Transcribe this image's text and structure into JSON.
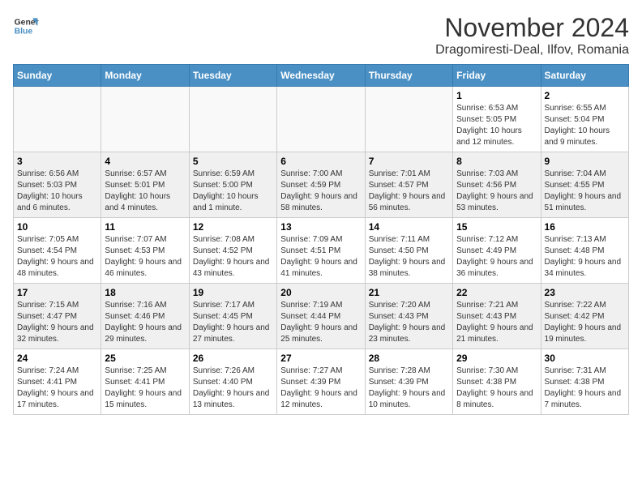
{
  "logo": {
    "line1": "General",
    "line2": "Blue"
  },
  "title": "November 2024",
  "location": "Dragomiresti-Deal, Ilfov, Romania",
  "weekdays": [
    "Sunday",
    "Monday",
    "Tuesday",
    "Wednesday",
    "Thursday",
    "Friday",
    "Saturday"
  ],
  "weeks": [
    [
      {
        "day": "",
        "info": ""
      },
      {
        "day": "",
        "info": ""
      },
      {
        "day": "",
        "info": ""
      },
      {
        "day": "",
        "info": ""
      },
      {
        "day": "",
        "info": ""
      },
      {
        "day": "1",
        "info": "Sunrise: 6:53 AM\nSunset: 5:05 PM\nDaylight: 10 hours and 12 minutes."
      },
      {
        "day": "2",
        "info": "Sunrise: 6:55 AM\nSunset: 5:04 PM\nDaylight: 10 hours and 9 minutes."
      }
    ],
    [
      {
        "day": "3",
        "info": "Sunrise: 6:56 AM\nSunset: 5:03 PM\nDaylight: 10 hours and 6 minutes."
      },
      {
        "day": "4",
        "info": "Sunrise: 6:57 AM\nSunset: 5:01 PM\nDaylight: 10 hours and 4 minutes."
      },
      {
        "day": "5",
        "info": "Sunrise: 6:59 AM\nSunset: 5:00 PM\nDaylight: 10 hours and 1 minute."
      },
      {
        "day": "6",
        "info": "Sunrise: 7:00 AM\nSunset: 4:59 PM\nDaylight: 9 hours and 58 minutes."
      },
      {
        "day": "7",
        "info": "Sunrise: 7:01 AM\nSunset: 4:57 PM\nDaylight: 9 hours and 56 minutes."
      },
      {
        "day": "8",
        "info": "Sunrise: 7:03 AM\nSunset: 4:56 PM\nDaylight: 9 hours and 53 minutes."
      },
      {
        "day": "9",
        "info": "Sunrise: 7:04 AM\nSunset: 4:55 PM\nDaylight: 9 hours and 51 minutes."
      }
    ],
    [
      {
        "day": "10",
        "info": "Sunrise: 7:05 AM\nSunset: 4:54 PM\nDaylight: 9 hours and 48 minutes."
      },
      {
        "day": "11",
        "info": "Sunrise: 7:07 AM\nSunset: 4:53 PM\nDaylight: 9 hours and 46 minutes."
      },
      {
        "day": "12",
        "info": "Sunrise: 7:08 AM\nSunset: 4:52 PM\nDaylight: 9 hours and 43 minutes."
      },
      {
        "day": "13",
        "info": "Sunrise: 7:09 AM\nSunset: 4:51 PM\nDaylight: 9 hours and 41 minutes."
      },
      {
        "day": "14",
        "info": "Sunrise: 7:11 AM\nSunset: 4:50 PM\nDaylight: 9 hours and 38 minutes."
      },
      {
        "day": "15",
        "info": "Sunrise: 7:12 AM\nSunset: 4:49 PM\nDaylight: 9 hours and 36 minutes."
      },
      {
        "day": "16",
        "info": "Sunrise: 7:13 AM\nSunset: 4:48 PM\nDaylight: 9 hours and 34 minutes."
      }
    ],
    [
      {
        "day": "17",
        "info": "Sunrise: 7:15 AM\nSunset: 4:47 PM\nDaylight: 9 hours and 32 minutes."
      },
      {
        "day": "18",
        "info": "Sunrise: 7:16 AM\nSunset: 4:46 PM\nDaylight: 9 hours and 29 minutes."
      },
      {
        "day": "19",
        "info": "Sunrise: 7:17 AM\nSunset: 4:45 PM\nDaylight: 9 hours and 27 minutes."
      },
      {
        "day": "20",
        "info": "Sunrise: 7:19 AM\nSunset: 4:44 PM\nDaylight: 9 hours and 25 minutes."
      },
      {
        "day": "21",
        "info": "Sunrise: 7:20 AM\nSunset: 4:43 PM\nDaylight: 9 hours and 23 minutes."
      },
      {
        "day": "22",
        "info": "Sunrise: 7:21 AM\nSunset: 4:43 PM\nDaylight: 9 hours and 21 minutes."
      },
      {
        "day": "23",
        "info": "Sunrise: 7:22 AM\nSunset: 4:42 PM\nDaylight: 9 hours and 19 minutes."
      }
    ],
    [
      {
        "day": "24",
        "info": "Sunrise: 7:24 AM\nSunset: 4:41 PM\nDaylight: 9 hours and 17 minutes."
      },
      {
        "day": "25",
        "info": "Sunrise: 7:25 AM\nSunset: 4:41 PM\nDaylight: 9 hours and 15 minutes."
      },
      {
        "day": "26",
        "info": "Sunrise: 7:26 AM\nSunset: 4:40 PM\nDaylight: 9 hours and 13 minutes."
      },
      {
        "day": "27",
        "info": "Sunrise: 7:27 AM\nSunset: 4:39 PM\nDaylight: 9 hours and 12 minutes."
      },
      {
        "day": "28",
        "info": "Sunrise: 7:28 AM\nSunset: 4:39 PM\nDaylight: 9 hours and 10 minutes."
      },
      {
        "day": "29",
        "info": "Sunrise: 7:30 AM\nSunset: 4:38 PM\nDaylight: 9 hours and 8 minutes."
      },
      {
        "day": "30",
        "info": "Sunrise: 7:31 AM\nSunset: 4:38 PM\nDaylight: 9 hours and 7 minutes."
      }
    ]
  ]
}
